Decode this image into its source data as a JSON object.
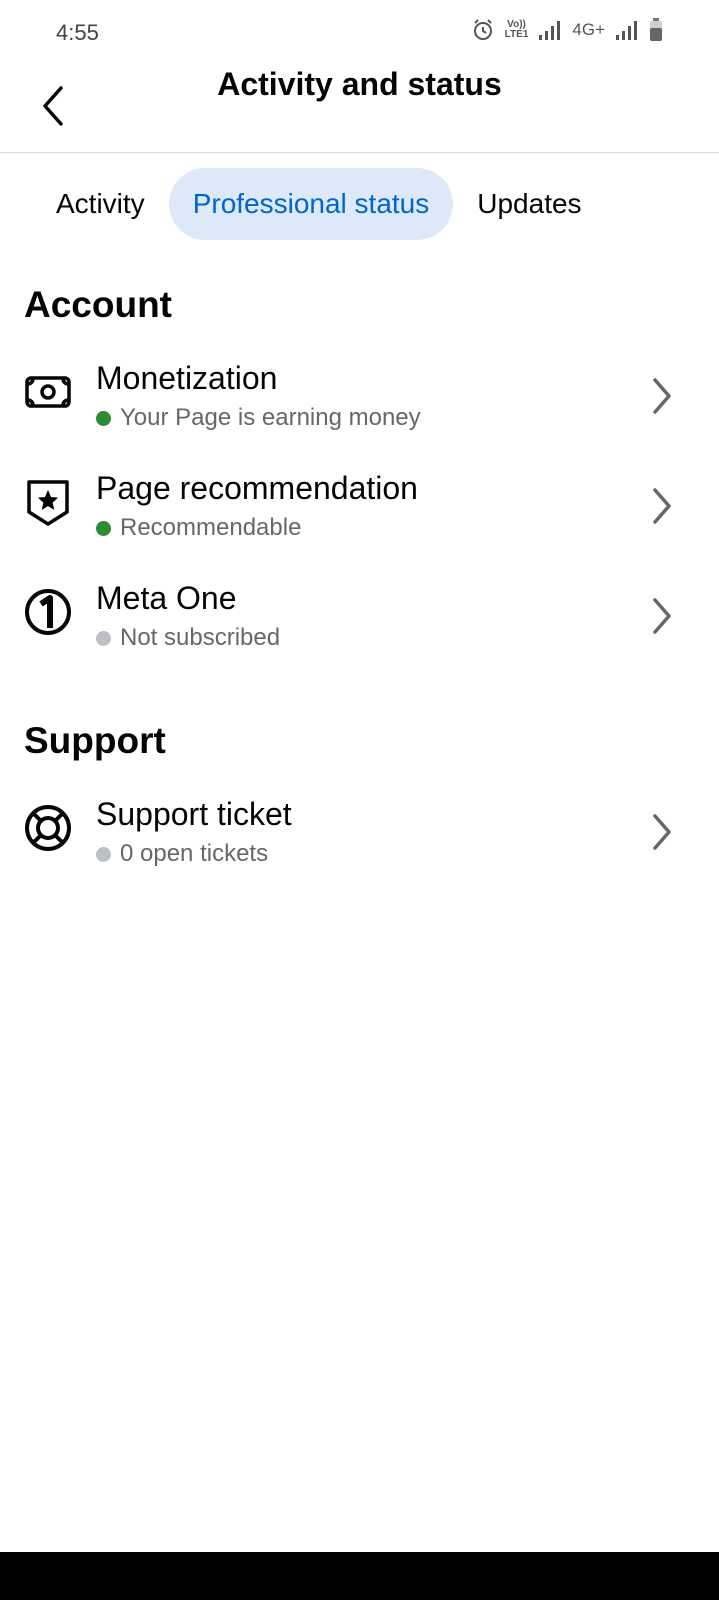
{
  "status_bar": {
    "time": "4:55",
    "icons": [
      "alarm-icon",
      "volte-icon",
      "signal-icon",
      "4g-plus-icon",
      "signal-icon",
      "battery-icon"
    ],
    "volte_top": "Vo))",
    "volte_bottom": "LTE1",
    "network": "4G+"
  },
  "header": {
    "title": "Activity and status",
    "back_icon": "chevron-left-icon"
  },
  "tabs": [
    {
      "label": "Activity",
      "active": false
    },
    {
      "label": "Professional status",
      "active": true
    },
    {
      "label": "Updates",
      "active": false
    }
  ],
  "sections": [
    {
      "title": "Account",
      "items": [
        {
          "title": "Monetization",
          "status": "Your Page is earning money",
          "status_color": "#2e8b33",
          "icon": "money-icon"
        },
        {
          "title": "Page recommendation",
          "status": "Recommendable",
          "status_color": "#2e8b33",
          "icon": "star-shield-icon"
        },
        {
          "title": "Meta One",
          "status": "Not subscribed",
          "status_color": "#bcc0c4",
          "icon": "meta-one-icon"
        }
      ]
    },
    {
      "title": "Support",
      "items": [
        {
          "title": "Support ticket",
          "status": "0 open tickets",
          "status_color": "#bcc0c4",
          "icon": "lifebuoy-icon"
        }
      ]
    }
  ],
  "colors": {
    "accent": "#0064d1",
    "active_tab_bg": "#dde9f8",
    "status_green": "#2e8b33",
    "status_gray": "#bcc0c4"
  }
}
